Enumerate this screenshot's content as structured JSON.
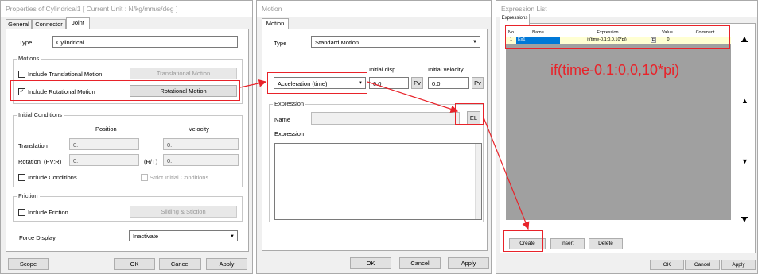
{
  "left": {
    "title": "Properties of Cylindrical1 [ Current Unit : N/kg/mm/s/deg ]",
    "tabs": [
      "General",
      "Connector",
      "Joint"
    ],
    "type_label": "Type",
    "type_value": "Cylindrical",
    "motions": {
      "title": "Motions",
      "trans_label": "Include Translational Motion",
      "trans_btn": "Translational Motion",
      "rot_label": "Include Rotational Motion",
      "rot_btn": "Rotational Motion",
      "rot_checked": "✓"
    },
    "init": {
      "title": "Initial Conditions",
      "pos": "Position",
      "vel": "Velocity",
      "translation": "Translation",
      "trans_pos": "0.",
      "trans_vel": "0.",
      "rotation": "Rotation",
      "pvr": "(PV:R)",
      "rot_pos": "0.",
      "rt": "(R/T)",
      "rot_vel": "0.",
      "include_cond": "Include Conditions",
      "strict": "Strict Initial Conditions"
    },
    "friction": {
      "title": "Friction",
      "include": "Include Friction",
      "btn": "Sliding & Stiction"
    },
    "force_label": "Force Display",
    "force_value": "Inactivate",
    "buttons": {
      "scope": "Scope",
      "ok": "OK",
      "cancel": "Cancel",
      "apply": "Apply"
    }
  },
  "mid": {
    "title": "Motion",
    "tab": "Motion",
    "type_label": "Type",
    "type_value": "Standard Motion",
    "init_disp": "Initial disp.",
    "init_vel": "Initial velocity",
    "motion_value": "Acceleration (time)",
    "disp_value": "0.0",
    "vel_value": "0.0",
    "pv": "Pv",
    "expr_group": "Expression",
    "name_label": "Name",
    "el": "EL",
    "expr_label": "Expression",
    "buttons": {
      "ok": "OK",
      "cancel": "Cancel",
      "apply": "Apply"
    }
  },
  "right": {
    "title": "Expression List",
    "tab": "Expressions",
    "headers": [
      "No",
      "Name",
      "Expression",
      "Value",
      "Comment"
    ],
    "row": {
      "no": "1",
      "name": "Ex1",
      "expr": "if(time-0.1:0,0,10*pi)",
      "e": "E",
      "value": "0",
      "comment": ""
    },
    "big": "if(time-0.1:0,0,10*pi)",
    "nav": [
      "▲",
      "▲",
      "▼",
      "▼"
    ],
    "buttons": {
      "create": "Create",
      "insert": "Insert",
      "delete": "Delete",
      "ok": "OK",
      "cancel": "Cancel",
      "apply": "Apply"
    }
  },
  "colors": {
    "accent_red": "#e8232a",
    "row_yellow": "#ffffd2",
    "name_blue": "#0078d7",
    "grid_bg": "#a0a0a0"
  }
}
